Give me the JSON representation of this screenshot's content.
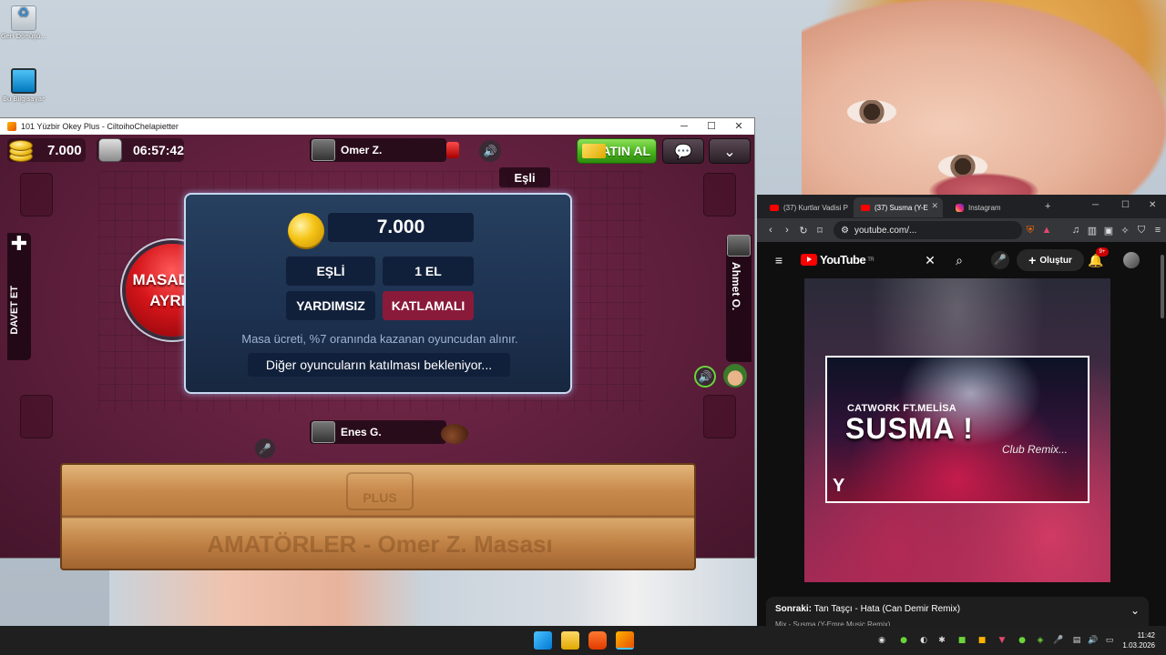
{
  "desktop": {
    "icons": [
      {
        "label": "Geri Dönüşü...",
        "icon": "recycle-bin-icon"
      },
      {
        "label": "Bu Bilgisayar",
        "icon": "computer-icon"
      }
    ]
  },
  "game_window": {
    "title": "101 Yüzbir Okey Plus - CiltoihoChelapietter",
    "controls": [
      "─",
      "☐",
      "✕"
    ],
    "topbar": {
      "chips": "7.000",
      "timer": "06:57:42",
      "buy_label": "SATIN AL"
    },
    "players": {
      "top": "Omer Z.",
      "bottom": "Enes G.",
      "right": "Ahmet O."
    },
    "partner_tab": "Eşli",
    "invite_label": "DAVET ET",
    "leave_button": {
      "line1": "MASADAN",
      "line2": "AYRIL"
    },
    "dialog": {
      "stake": "7.000",
      "options": [
        "EŞLİ",
        "1 EL",
        "YARDIMSIZ",
        "KATLAMALI"
      ],
      "fee_note": "Masa ücreti, %7 oranında kazanan oyuncudan alınır.",
      "waiting": "Diğer oyuncuların katılması bekleniyor..."
    },
    "rack": {
      "logo": "PLUS",
      "label": "AMATÖRLER - Omer Z. Masası"
    }
  },
  "browser": {
    "tabs": [
      {
        "label": "(37) Kurtlar Vadisi P",
        "icon": "youtube-icon",
        "active": false
      },
      {
        "label": "(37) Susma (Y-E",
        "icon": "youtube-icon",
        "active": true
      },
      {
        "label": "Instagram",
        "icon": "instagram-icon",
        "active": false
      }
    ],
    "address": "youtube.com/...",
    "youtube": {
      "logo": "YouTube",
      "region": "TR",
      "create_label": "Oluştur",
      "notif_count": "9+",
      "thumbnail": {
        "artist": "CATWORK FT.MELİSA",
        "song": "SUSMA !",
        "remix": "Club Remix...",
        "brand": "Y"
      },
      "up_next_prefix": "Sonraki:",
      "up_next_title": "Tan Taşçı - Hata (Can Demir Remix)",
      "playlist": "Mix - Susma (Y-Emre Music Remix)"
    }
  },
  "taskbar": {
    "time": "11:42",
    "date": "1.03.2026"
  }
}
